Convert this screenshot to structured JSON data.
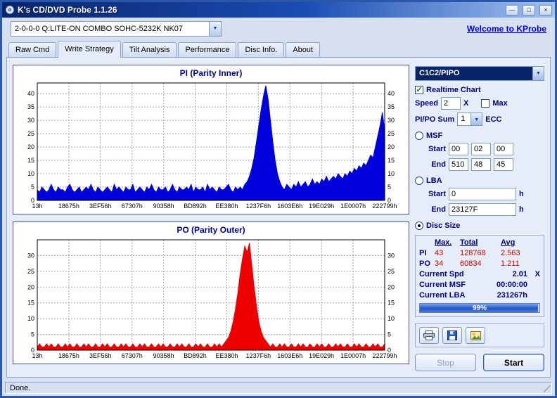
{
  "window": {
    "title": "K's CD/DVD Probe 1.1.26",
    "status": "Done."
  },
  "icons": {
    "minimize": "—",
    "maximize": "□",
    "close": "×",
    "dropdown": "▼",
    "check": "✓"
  },
  "toolbar": {
    "drive_combo": "2-0-0-0 Q:LITE-ON COMBO SOHC-5232K NK07",
    "link": "Welcome to KProbe"
  },
  "tabs": [
    {
      "label": "Raw Cmd"
    },
    {
      "label": "Write Strategy"
    },
    {
      "label": "Tilt Analysis"
    },
    {
      "label": "Performance"
    },
    {
      "label": "Disc Info."
    },
    {
      "label": "About"
    }
  ],
  "controls": {
    "mode_combo": "C1C2/PIPO",
    "realtime_label": "Realtime Chart",
    "speed_label": "Speed",
    "speed_value": "2",
    "speed_unit": "X",
    "max_label": "Max",
    "pipo_sum_label": "PI/PO Sum",
    "pipo_sum_value": "1",
    "ecc_label": "ECC",
    "msf_label": "MSF",
    "start_label": "Start",
    "end_label": "End",
    "msf_start": [
      "00",
      "02",
      "00"
    ],
    "msf_end": [
      "510",
      "48",
      "45"
    ],
    "lba_label": "LBA",
    "lba_start": "0",
    "lba_end": "23127F",
    "hex_unit": "h",
    "disc_size_label": "Disc Size",
    "stats": {
      "headers": [
        "Max.",
        "Total",
        "Avg"
      ],
      "rows": [
        {
          "name": "PI",
          "max": "43",
          "total": "128768",
          "avg": "2.563"
        },
        {
          "name": "PO",
          "max": "34",
          "total": "60834",
          "avg": "1.211"
        }
      ]
    },
    "current": [
      {
        "label": "Current Spd",
        "value": "2.01",
        "unit": "X"
      },
      {
        "label": "Current MSF",
        "value": "00:00:00",
        "unit": ""
      },
      {
        "label": "Current LBA",
        "value": "231267h",
        "unit": ""
      }
    ],
    "progress_percent": 99,
    "progress_label": "99%",
    "buttons": {
      "stop": "Stop",
      "start": "Start"
    }
  },
  "chart_data": [
    {
      "type": "area",
      "title": "PI (Parity Inner)",
      "color": "#0000dd",
      "ymax": 44,
      "yticks": [
        0,
        5,
        10,
        15,
        20,
        25,
        30,
        35,
        40
      ],
      "categories": [
        "13h",
        "18675h",
        "3EF56h",
        "67307h",
        "90358h",
        "BD892h",
        "EE380h",
        "1237F6h",
        "1603E6h",
        "19E029h",
        "1E0007h",
        "222799h"
      ],
      "values": [
        4,
        3,
        5,
        4,
        3,
        4,
        6,
        4,
        3,
        5,
        4,
        4,
        3,
        5,
        6,
        4,
        3,
        4,
        5,
        3,
        4,
        5,
        4,
        6,
        4,
        3,
        5,
        4,
        3,
        4,
        5,
        4,
        3,
        6,
        4,
        5,
        4,
        3,
        5,
        4,
        4,
        6,
        3,
        4,
        5,
        4,
        3,
        5,
        4,
        6,
        4,
        3,
        5,
        4,
        4,
        5,
        3,
        4,
        6,
        4,
        3,
        5,
        4,
        4,
        5,
        4,
        6,
        3,
        5,
        4,
        4,
        5,
        3,
        6,
        4,
        5,
        4,
        3,
        5,
        4,
        4,
        5,
        6,
        4,
        3,
        5,
        4,
        5,
        4,
        6,
        7,
        9,
        12,
        16,
        22,
        28,
        34,
        39,
        43,
        38,
        30,
        22,
        15,
        10,
        7,
        5,
        4,
        6,
        5,
        4,
        6,
        5,
        7,
        5,
        6,
        7,
        5,
        6,
        8,
        6,
        7,
        6,
        8,
        7,
        9,
        7,
        8,
        9,
        8,
        10,
        9,
        8,
        10,
        9,
        11,
        10,
        12,
        11,
        13,
        12,
        14,
        13,
        15,
        17,
        16,
        20,
        24,
        28,
        33,
        26
      ]
    },
    {
      "type": "area",
      "title": "PO (Parity Outer)",
      "color": "#ee0000",
      "ymax": 35,
      "yticks": [
        0,
        5,
        10,
        15,
        20,
        25,
        30
      ],
      "categories": [
        "13h",
        "18675h",
        "3EF56h",
        "67307h",
        "90358h",
        "BD892h",
        "EE380h",
        "1237F6h",
        "1603E6h",
        "19E029h",
        "1E0007h",
        "222799h"
      ],
      "values": [
        1,
        2,
        1,
        1,
        2,
        1,
        2,
        1,
        1,
        2,
        1,
        1,
        2,
        1,
        2,
        1,
        1,
        2,
        1,
        1,
        2,
        1,
        2,
        1,
        1,
        2,
        1,
        1,
        2,
        1,
        2,
        1,
        1,
        2,
        1,
        1,
        2,
        1,
        2,
        1,
        1,
        2,
        1,
        1,
        2,
        1,
        2,
        1,
        1,
        2,
        1,
        1,
        2,
        1,
        2,
        1,
        1,
        2,
        1,
        1,
        2,
        1,
        2,
        1,
        1,
        2,
        1,
        1,
        2,
        1,
        2,
        1,
        1,
        2,
        1,
        1,
        2,
        1,
        2,
        1,
        2,
        3,
        4,
        6,
        9,
        13,
        18,
        24,
        29,
        33,
        31,
        34,
        27,
        20,
        14,
        9,
        6,
        4,
        3,
        2,
        1,
        2,
        1,
        1,
        2,
        1,
        2,
        1,
        1,
        2,
        1,
        1,
        2,
        1,
        2,
        1,
        1,
        2,
        1,
        1,
        2,
        1,
        2,
        1,
        1,
        2,
        1,
        1,
        2,
        1,
        2,
        1,
        1,
        2,
        1,
        1,
        2,
        1,
        2,
        1,
        1,
        2,
        1,
        1,
        2,
        1,
        2,
        1,
        1,
        2
      ]
    }
  ]
}
